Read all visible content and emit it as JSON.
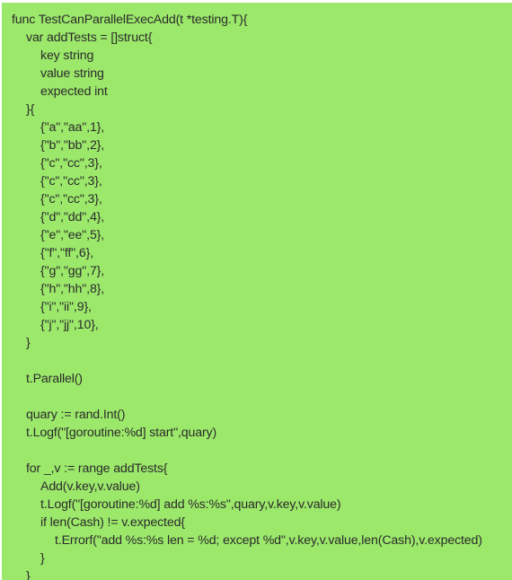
{
  "editor": {
    "background_color": "#9ce86b",
    "text_color": "#2b2b2b",
    "language": "Go",
    "outer_margin_color": "#ffffff"
  },
  "code": {
    "lines": [
      {
        "indent": 0,
        "text": "func TestCanParallelExecAdd(t *testing.T){"
      },
      {
        "indent": 1,
        "text": "var addTests = []struct{"
      },
      {
        "indent": 2,
        "text": "key string"
      },
      {
        "indent": 2,
        "text": "value string"
      },
      {
        "indent": 2,
        "text": "expected int"
      },
      {
        "indent": 1,
        "text": "}{"
      },
      {
        "indent": 2,
        "text": "{\"a\",\"aa\",1},"
      },
      {
        "indent": 2,
        "text": "{\"b\",\"bb\",2},"
      },
      {
        "indent": 2,
        "text": "{\"c\",\"cc\",3},"
      },
      {
        "indent": 2,
        "text": "{\"c\",\"cc\",3},"
      },
      {
        "indent": 2,
        "text": "{\"c\",\"cc\",3},"
      },
      {
        "indent": 2,
        "text": "{\"d\",\"dd\",4},"
      },
      {
        "indent": 2,
        "text": "{\"e\",\"ee\",5},"
      },
      {
        "indent": 2,
        "text": "{\"f\",\"ff\",6},"
      },
      {
        "indent": 2,
        "text": "{\"g\",\"gg\",7},"
      },
      {
        "indent": 2,
        "text": "{\"h\",\"hh\",8},"
      },
      {
        "indent": 2,
        "text": "{\"i\",\"ii\",9},"
      },
      {
        "indent": 2,
        "text": "{\"j\",\"jj\",10},"
      },
      {
        "indent": 1,
        "text": "}"
      },
      {
        "indent": 0,
        "text": ""
      },
      {
        "indent": 1,
        "text": "t.Parallel()"
      },
      {
        "indent": 0,
        "text": ""
      },
      {
        "indent": 1,
        "text": "quary := rand.Int()"
      },
      {
        "indent": 1,
        "text": "t.Logf(\"[goroutine:%d] start\",quary)"
      },
      {
        "indent": 0,
        "text": ""
      },
      {
        "indent": 1,
        "text": "for _,v := range addTests{"
      },
      {
        "indent": 2,
        "text": "Add(v.key,v.value)"
      },
      {
        "indent": 2,
        "text": "t.Logf(\"[goroutine:%d] add %s:%s\",quary,v.key,v.value)"
      },
      {
        "indent": 2,
        "text": "if len(Cash) != v.expected{"
      },
      {
        "indent": 3,
        "text": "t.Errorf(\"add %s:%s len = %d; except %d\",v.key,v.value,len(Cash),v.expected)"
      },
      {
        "indent": 2,
        "text": "}"
      },
      {
        "indent": 1,
        "text": "}"
      }
    ]
  }
}
